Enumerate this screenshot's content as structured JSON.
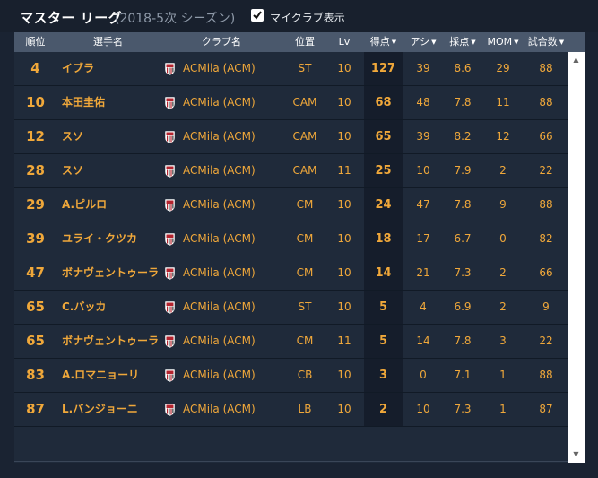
{
  "header": {
    "title": "マスター リーグ",
    "subtitle": "(2018-5次 シーズン)",
    "myclub_label": "マイクラブ表示",
    "myclub_checked": true
  },
  "columns": {
    "rank": "順位",
    "player": "選手名",
    "club": "クラブ名",
    "position": "位置",
    "level": "Lv",
    "goals": "得点",
    "assists": "アシ",
    "rating": "採点",
    "mom": "MOM",
    "matches": "試合数"
  },
  "rows": [
    {
      "rank": "4",
      "player": "イブラ",
      "club": "ACMila (ACM)",
      "position": "ST",
      "level": "10",
      "goals": "127",
      "assists": "39",
      "rating": "8.6",
      "mom": "29",
      "matches": "88"
    },
    {
      "rank": "10",
      "player": "本田圭佑",
      "club": "ACMila (ACM)",
      "position": "CAM",
      "level": "10",
      "goals": "68",
      "assists": "48",
      "rating": "7.8",
      "mom": "11",
      "matches": "88"
    },
    {
      "rank": "12",
      "player": "スソ",
      "club": "ACMila (ACM)",
      "position": "CAM",
      "level": "10",
      "goals": "65",
      "assists": "39",
      "rating": "8.2",
      "mom": "12",
      "matches": "66"
    },
    {
      "rank": "28",
      "player": "スソ",
      "club": "ACMila (ACM)",
      "position": "CAM",
      "level": "11",
      "goals": "25",
      "assists": "10",
      "rating": "7.9",
      "mom": "2",
      "matches": "22"
    },
    {
      "rank": "29",
      "player": "A.ピルロ",
      "club": "ACMila (ACM)",
      "position": "CM",
      "level": "10",
      "goals": "24",
      "assists": "47",
      "rating": "7.8",
      "mom": "9",
      "matches": "88"
    },
    {
      "rank": "39",
      "player": "ユライ・クツカ",
      "club": "ACMila (ACM)",
      "position": "CM",
      "level": "10",
      "goals": "18",
      "assists": "17",
      "rating": "6.7",
      "mom": "0",
      "matches": "82"
    },
    {
      "rank": "47",
      "player": "ボナヴェントゥーラ",
      "club": "ACMila (ACM)",
      "position": "CM",
      "level": "10",
      "goals": "14",
      "assists": "21",
      "rating": "7.3",
      "mom": "2",
      "matches": "66"
    },
    {
      "rank": "65",
      "player": "C.バッカ",
      "club": "ACMila (ACM)",
      "position": "ST",
      "level": "10",
      "goals": "5",
      "assists": "4",
      "rating": "6.9",
      "mom": "2",
      "matches": "9"
    },
    {
      "rank": "65",
      "player": "ボナヴェントゥーラ",
      "club": "ACMila (ACM)",
      "position": "CM",
      "level": "11",
      "goals": "5",
      "assists": "14",
      "rating": "7.8",
      "mom": "3",
      "matches": "22"
    },
    {
      "rank": "83",
      "player": "A.ロマニョーリ",
      "club": "ACMila (ACM)",
      "position": "CB",
      "level": "10",
      "goals": "3",
      "assists": "0",
      "rating": "7.1",
      "mom": "1",
      "matches": "88"
    },
    {
      "rank": "87",
      "player": "L.バンジョーニ",
      "club": "ACMila (ACM)",
      "position": "LB",
      "level": "10",
      "goals": "2",
      "assists": "10",
      "rating": "7.3",
      "mom": "1",
      "matches": "87"
    }
  ],
  "icons": {
    "checkbox": "checkmark-icon",
    "club_badge": "acmilan-crest-icon",
    "sort": "caret-down-icon",
    "scroll_up": "scroll-up-arrow-icon",
    "scroll_down": "scroll-down-arrow-icon"
  },
  "colors": {
    "accent": "#f0a83a",
    "background": "#1a2332",
    "header_bg": "#4a586c",
    "badge_red": "#b3242f"
  }
}
